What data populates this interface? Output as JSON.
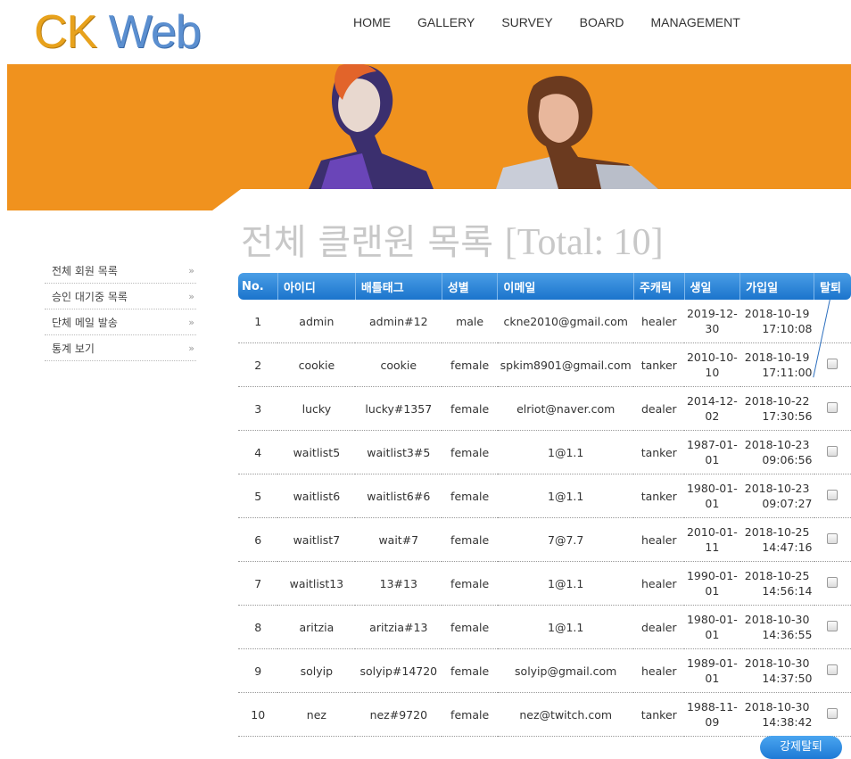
{
  "logo": {
    "part1": "CK",
    "part2": "Web"
  },
  "nav": [
    "HOME",
    "GALLERY",
    "SURVEY",
    "BOARD",
    "MANAGEMENT"
  ],
  "sidebar": {
    "items": [
      {
        "label": "전체 회원 목록",
        "arrow": "»"
      },
      {
        "label": "승인 대기중 목록",
        "arrow": "»"
      },
      {
        "label": "단체 메일 발송",
        "arrow": "»"
      },
      {
        "label": "통계 보기",
        "arrow": "»"
      }
    ]
  },
  "page": {
    "title": "전체 클랜원 목록",
    "total": "[Total: 10]"
  },
  "table": {
    "headers": [
      "No.",
      "아이디",
      "배틀태그",
      "성별",
      "이메일",
      "주캐릭",
      "생일",
      "가입일",
      "탈퇴"
    ],
    "rows": [
      {
        "no": "1",
        "id": "admin",
        "tag": "admin#12",
        "gender": "male",
        "email": "ckne2010@gmail.com",
        "main": "healer",
        "birth1": "2019-12-",
        "birth2": "30",
        "join1": "2018-10-19",
        "join2": "17:10:08",
        "checkbox": false
      },
      {
        "no": "2",
        "id": "cookie",
        "tag": "cookie",
        "gender": "female",
        "email": "spkim8901@gmail.com",
        "main": "tanker",
        "birth1": "2010-10-",
        "birth2": "10",
        "join1": "2018-10-19",
        "join2": "17:11:00",
        "checkbox": true
      },
      {
        "no": "3",
        "id": "lucky",
        "tag": "lucky#1357",
        "gender": "female",
        "email": "elriot@naver.com",
        "main": "dealer",
        "birth1": "2014-12-",
        "birth2": "02",
        "join1": "2018-10-22",
        "join2": "17:30:56",
        "checkbox": true
      },
      {
        "no": "4",
        "id": "waitlist5",
        "tag": "waitlist3#5",
        "gender": "female",
        "email": "1@1.1",
        "main": "tanker",
        "birth1": "1987-01-",
        "birth2": "01",
        "join1": "2018-10-23",
        "join2": "09:06:56",
        "checkbox": true
      },
      {
        "no": "5",
        "id": "waitlist6",
        "tag": "waitlist6#6",
        "gender": "female",
        "email": "1@1.1",
        "main": "tanker",
        "birth1": "1980-01-",
        "birth2": "01",
        "join1": "2018-10-23",
        "join2": "09:07:27",
        "checkbox": true
      },
      {
        "no": "6",
        "id": "waitlist7",
        "tag": "wait#7",
        "gender": "female",
        "email": "7@7.7",
        "main": "healer",
        "birth1": "2010-01-",
        "birth2": "11",
        "join1": "2018-10-25",
        "join2": "14:47:16",
        "checkbox": true
      },
      {
        "no": "7",
        "id": "waitlist13",
        "tag": "13#13",
        "gender": "female",
        "email": "1@1.1",
        "main": "healer",
        "birth1": "1990-01-",
        "birth2": "01",
        "join1": "2018-10-25",
        "join2": "14:56:14",
        "checkbox": true
      },
      {
        "no": "8",
        "id": "aritzia",
        "tag": "aritzia#13",
        "gender": "female",
        "email": "1@1.1",
        "main": "dealer",
        "birth1": "1980-01-",
        "birth2": "01",
        "join1": "2018-10-30",
        "join2": "14:36:55",
        "checkbox": true
      },
      {
        "no": "9",
        "id": "solyip",
        "tag": "solyip#14720",
        "gender": "female",
        "email": "solyip@gmail.com",
        "main": "healer",
        "birth1": "1989-01-",
        "birth2": "01",
        "join1": "2018-10-30",
        "join2": "14:37:50",
        "checkbox": true
      },
      {
        "no": "10",
        "id": "nez",
        "tag": "nez#9720",
        "gender": "female",
        "email": "nez@twitch.com",
        "main": "tanker",
        "birth1": "1988-11-",
        "birth2": "09",
        "join1": "2018-10-30",
        "join2": "14:38:42",
        "checkbox": true
      }
    ]
  },
  "actions": {
    "kick_label": "강제탈퇴"
  },
  "colors": {
    "banner": "#f0921e",
    "header_blue": "#1b74cc",
    "logo_orange": "#e8a21c",
    "logo_blue": "#5b8fd0"
  }
}
